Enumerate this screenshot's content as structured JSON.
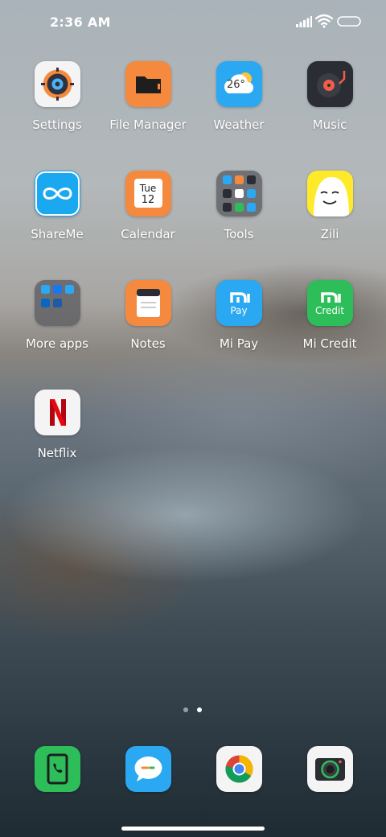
{
  "status_bar": {
    "time": "2:36 AM"
  },
  "apps": {
    "settings": {
      "label": "Settings",
      "icon": "settings-icon"
    },
    "file_manager": {
      "label": "File Manager",
      "icon": "folder-icon"
    },
    "weather": {
      "label": "Weather",
      "icon": "weather-icon",
      "temp": "26°"
    },
    "music": {
      "label": "Music",
      "icon": "music-icon"
    },
    "shareme": {
      "label": "ShareMe",
      "icon": "infinity-icon"
    },
    "calendar": {
      "label": "Calendar",
      "icon": "calendar-icon",
      "day": "Tue",
      "date": "12"
    },
    "tools": {
      "label": "Tools",
      "icon": "folder-grid-icon"
    },
    "zili": {
      "label": "Zili",
      "icon": "zili-face-icon"
    },
    "more_apps": {
      "label": "More apps",
      "icon": "folder-grid-icon"
    },
    "notes": {
      "label": "Notes",
      "icon": "notes-icon"
    },
    "mi_pay": {
      "label": "Mi Pay",
      "icon": "mi-pay-icon",
      "sub": "Pay"
    },
    "mi_credit": {
      "label": "Mi Credit",
      "icon": "mi-credit-icon",
      "sub": "Credit"
    },
    "netflix": {
      "label": "Netflix",
      "icon": "netflix-icon"
    }
  },
  "page_indicator": {
    "pages": 2,
    "current": 2
  },
  "dock": [
    "phone-icon",
    "messages-icon",
    "chrome-icon",
    "camera-icon"
  ],
  "colors": {
    "file_manager": "#F58A3E",
    "weather": "#2AA9F2",
    "music": "#2A2D33",
    "shareme": "#1AA8F0",
    "calendar": "#F58A3E",
    "zili": "#FFEA2A",
    "notes": "#F58A3E",
    "mi_pay": "#2AA9F2",
    "mi_credit": "#2DBE5A",
    "phone": "#2DBE5A",
    "messages": "#2AA9F2"
  }
}
